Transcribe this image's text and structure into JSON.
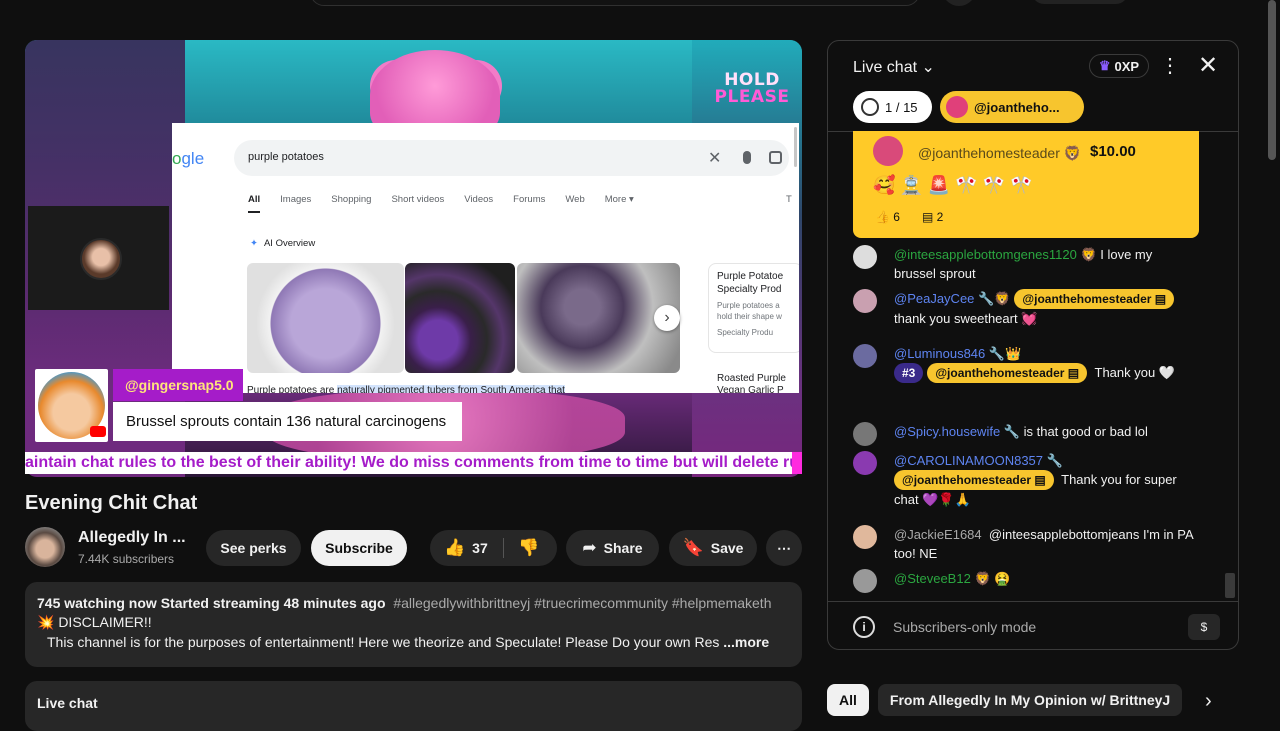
{
  "player": {
    "hold_line1": "HOLD",
    "hold_line2": "PLEASE",
    "google": {
      "logo": "gle",
      "query": "purple potatoes",
      "tabs": [
        "All",
        "Images",
        "Shopping",
        "Short videos",
        "Videos",
        "Forums",
        "Web",
        "More ▾"
      ],
      "tab_trailing": "T",
      "ai_overview": "AI Overview",
      "card_title": "Purple Potatoe Specialty Prod",
      "card_snippet": "Purple potatoes a hold their shape w",
      "card_source": "Specialty Produ",
      "roasted": "Roasted Purple Vegan Garlic P",
      "paragraph_start": "Purple potatoes are ",
      "paragraph_highlight": "naturally pigmented tubers from South America that"
    },
    "comment_user": "@gingersnap5.0",
    "comment_text": "Brussel sprouts contain 136 natural carcinogens",
    "ticker": "aintain chat rules to the best of their ability! We do miss comments from time to time but will delete rude a"
  },
  "video": {
    "title": "Evening Chit Chat",
    "channel_name": "Allegedly In ...",
    "subscribers": "7.44K subscribers",
    "see_perks": "See perks",
    "subscribe": "Subscribe",
    "likes": "37",
    "share": "Share",
    "save": "Save",
    "more": "⋯"
  },
  "description": {
    "stats": "745 watching now  Started streaming 48 minutes ago",
    "tags": "#allegedlywithbrittneyj #truecrimecommunity #helpmemaketh",
    "disclaimer": "💥 DISCLAIMER!!",
    "line3": "This channel is for the purposes of entertainment!  Here we theorize and Speculate!  Please Do your own Res",
    "more": "...more"
  },
  "live_chat_bar": "Live chat",
  "chat": {
    "title": "Live chat",
    "chevron": "⌄",
    "xp": "0XP",
    "goal": "1 / 15",
    "pinned_user": "@joantheho...",
    "superchat": {
      "user": "@joanthehomesteader",
      "amount": "$10.00",
      "emojis": "🥰🚊🚨🎌🎌🎌",
      "likes": "6",
      "replies": "2"
    },
    "messages": [
      {
        "user": "@inteesapplebottomgenes1120",
        "badge": "🦁",
        "text": "I love my brussel sprout"
      },
      {
        "user": "@PeaJayCee",
        "badge": "🔧🦁",
        "tag": "@joanthehomesteader ▤",
        "text": "thank you sweetheart 💓"
      },
      {
        "user": "@Luminous846",
        "badge": "🔧👑",
        "rank": "#3",
        "tag": "@joanthehomesteader ▤",
        "text": "Thank you 🤍"
      },
      {
        "user": "@Spicy.housewife",
        "badge": "🔧",
        "text": "is that good or bad lol"
      },
      {
        "user": "@CAROLINAMOON8357",
        "badge": "🔧",
        "tag": "@joanthehomesteader ▤",
        "text": "Thank you for super chat 💜🌹🙏"
      },
      {
        "user": "@JackieE1684",
        "text": "@inteesapplebottomjeans I'm in PA too! NE"
      },
      {
        "user": "@SteveeB12",
        "badge": "🦁",
        "text": "🤮"
      }
    ],
    "subscribers_only": "Subscribers-only mode"
  },
  "chips": [
    "All",
    "From Allegedly In My Opinion w/ BrittneyJ"
  ],
  "colors": {
    "accent_yellow": "#f7c52e",
    "username_green": "#2ba640",
    "username_blue": "#5e84f1",
    "overlay_purple": "#a51cc9"
  }
}
